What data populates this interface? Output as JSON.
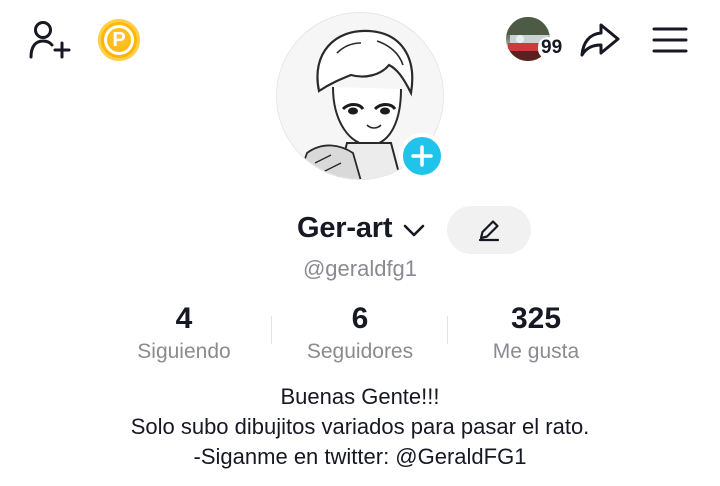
{
  "profile": {
    "display_name": "Ger-art",
    "username": "@geraldfg1"
  },
  "topbar": {
    "coin_letter": "P",
    "friend_count": "99"
  },
  "stats": [
    {
      "value": "4",
      "label": "Siguiendo"
    },
    {
      "value": "6",
      "label": "Seguidores"
    },
    {
      "value": "325",
      "label": "Me gusta"
    }
  ],
  "bio": [
    "Buenas Gente!!!",
    "Solo subo dibujitos variados para pasar el rato.",
    "-Siganme en twitter: @GeraldFG1"
  ],
  "colors": {
    "accent_blue": "#20c4ea",
    "coin_gold": "#ffb400",
    "muted_text": "#8a8b91"
  },
  "icons": {
    "add_friend": "person-plus-icon",
    "coin": "coin-icon",
    "share": "share-arrow-icon",
    "menu": "hamburger-menu-icon",
    "avatar_add": "plus-icon",
    "name_dropdown": "chevron-down-icon",
    "edit": "pencil-icon"
  }
}
